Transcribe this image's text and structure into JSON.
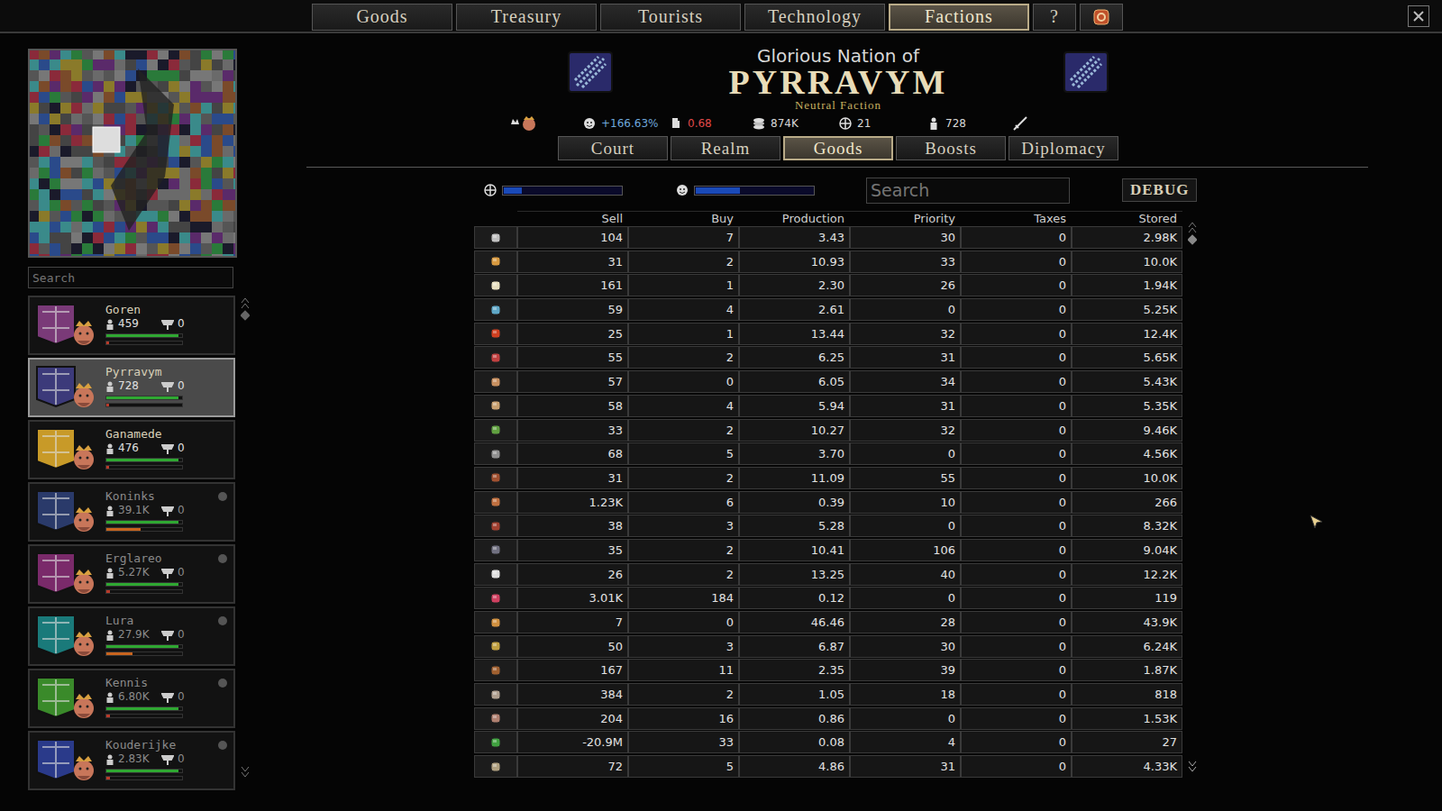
{
  "top_tabs": [
    {
      "label": "Goods",
      "selected": false
    },
    {
      "label": "Treasury",
      "selected": false
    },
    {
      "label": "Tourists",
      "selected": false
    },
    {
      "label": "Technology",
      "selected": false
    },
    {
      "label": "Factions",
      "selected": true
    },
    {
      "label": "?",
      "selected": false
    }
  ],
  "sidebar": {
    "search": {
      "placeholder": "Search"
    },
    "items": [
      {
        "name": "Goren",
        "population": "459",
        "count": "0",
        "selected": false,
        "dimmed": false,
        "level": 0.95,
        "level2": 0.03,
        "color": "#7a3a78"
      },
      {
        "name": "Pyrravym",
        "population": "728",
        "count": "0",
        "selected": true,
        "dimmed": false,
        "level": 0.95,
        "level2": 0.03,
        "color": "#3c3a7a"
      },
      {
        "name": "Ganamede",
        "population": "476",
        "count": "0",
        "selected": false,
        "dimmed": false,
        "level": 0.95,
        "level2": 0.03,
        "color": "#c89a28"
      },
      {
        "name": "Koninks",
        "population": "39.1K",
        "count": "0",
        "selected": false,
        "dimmed": true,
        "level": 0.95,
        "level2": 0.45,
        "color": "#2a3a6a"
      },
      {
        "name": "Erglareo",
        "population": "5.27K",
        "count": "0",
        "selected": false,
        "dimmed": true,
        "level": 0.95,
        "level2": 0.05,
        "color": "#7a2a6a"
      },
      {
        "name": "Lura",
        "population": "27.9K",
        "count": "0",
        "selected": false,
        "dimmed": true,
        "level": 0.95,
        "level2": 0.35,
        "color": "#1a7a7a"
      },
      {
        "name": "Kennis",
        "population": "6.80K",
        "count": "0",
        "selected": false,
        "dimmed": true,
        "level": 0.95,
        "level2": 0.05,
        "color": "#3a8a2a"
      },
      {
        "name": "Kouderijke",
        "population": "2.83K",
        "count": "0",
        "selected": false,
        "dimmed": true,
        "level": 0.95,
        "level2": 0.05,
        "color": "#2a3a8a"
      }
    ]
  },
  "header": {
    "subtitle": "Glorious Nation of",
    "name": "PYRRAVYM",
    "type": "Neutral Faction"
  },
  "stats": [
    {
      "value": "+166.63%",
      "color": "#6fa8dc"
    },
    {
      "value": "0.68",
      "color": "#e04a4a"
    },
    {
      "value": "874K",
      "color": "#d8d8d8"
    },
    {
      "value": "21",
      "color": "#d8d8d8"
    },
    {
      "value": "728",
      "color": "#d8d8d8"
    }
  ],
  "sub_tabs": [
    {
      "label": "Court",
      "selected": false
    },
    {
      "label": "Realm",
      "selected": false
    },
    {
      "label": "Goods",
      "selected": true
    },
    {
      "label": "Boosts",
      "selected": false
    },
    {
      "label": "Diplomacy",
      "selected": false
    }
  ],
  "controls": {
    "slider1": {
      "level": 0.15
    },
    "slider2": {
      "level": 0.38
    },
    "search": {
      "placeholder": "Search"
    },
    "debug": "DEBUG"
  },
  "table": {
    "columns": [
      "Sell",
      "Buy",
      "Production",
      "Priority",
      "Taxes",
      "Stored"
    ],
    "rows": [
      [
        "104",
        "7",
        "3.43",
        "30",
        "0",
        "2.98K"
      ],
      [
        "31",
        "2",
        "10.93",
        "33",
        "0",
        "10.0K"
      ],
      [
        "161",
        "1",
        "2.30",
        "26",
        "0",
        "1.94K"
      ],
      [
        "59",
        "4",
        "2.61",
        "0",
        "0",
        "5.25K"
      ],
      [
        "25",
        "1",
        "13.44",
        "32",
        "0",
        "12.4K"
      ],
      [
        "55",
        "2",
        "6.25",
        "31",
        "0",
        "5.65K"
      ],
      [
        "57",
        "0",
        "6.05",
        "34",
        "0",
        "5.43K"
      ],
      [
        "58",
        "4",
        "5.94",
        "31",
        "0",
        "5.35K"
      ],
      [
        "33",
        "2",
        "10.27",
        "32",
        "0",
        "9.46K"
      ],
      [
        "68",
        "5",
        "3.70",
        "0",
        "0",
        "4.56K"
      ],
      [
        "31",
        "2",
        "11.09",
        "55",
        "0",
        "10.0K"
      ],
      [
        "1.23K",
        "6",
        "0.39",
        "10",
        "0",
        "266"
      ],
      [
        "38",
        "3",
        "5.28",
        "0",
        "0",
        "8.32K"
      ],
      [
        "35",
        "2",
        "10.41",
        "106",
        "0",
        "9.04K"
      ],
      [
        "26",
        "2",
        "13.25",
        "40",
        "0",
        "12.2K"
      ],
      [
        "3.01K",
        "184",
        "0.12",
        "0",
        "0",
        "119"
      ],
      [
        "7",
        "0",
        "46.46",
        "28",
        "0",
        "43.9K"
      ],
      [
        "50",
        "3",
        "6.87",
        "30",
        "0",
        "6.24K"
      ],
      [
        "167",
        "11",
        "2.35",
        "39",
        "0",
        "1.87K"
      ],
      [
        "384",
        "2",
        "1.05",
        "18",
        "0",
        "818"
      ],
      [
        "204",
        "16",
        "0.86",
        "0",
        "0",
        "1.53K"
      ],
      [
        "-20.9M",
        "33",
        "0.08",
        "4",
        "0",
        "27"
      ],
      [
        "72",
        "5",
        "4.86",
        "31",
        "0",
        "4.33K"
      ]
    ]
  }
}
